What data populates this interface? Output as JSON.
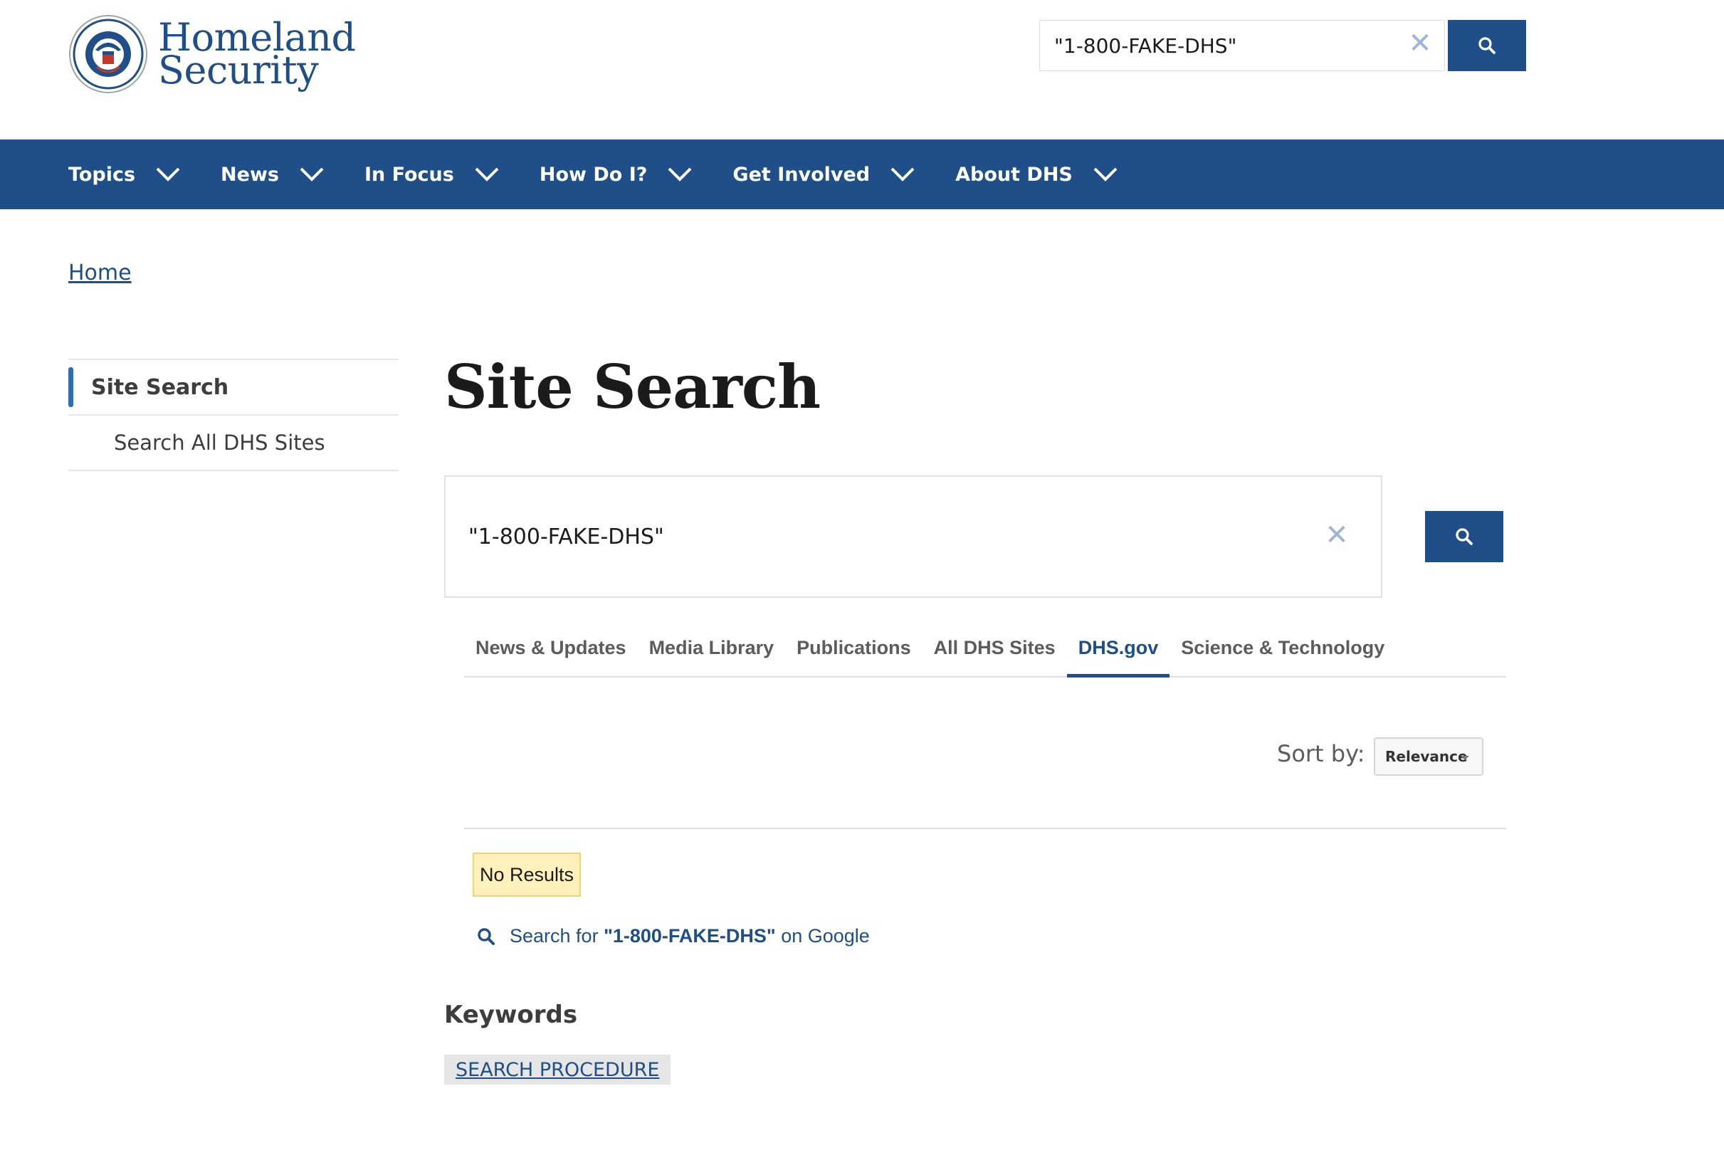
{
  "header": {
    "logo_line1": "Homeland",
    "logo_line2": "Security",
    "search_value": "\"1-800-FAKE-DHS\"",
    "clear_symbol": "✕"
  },
  "nav": {
    "items": [
      {
        "label": "Topics"
      },
      {
        "label": "News"
      },
      {
        "label": "In Focus"
      },
      {
        "label": "How Do I?"
      },
      {
        "label": "Get Involved"
      },
      {
        "label": "About DHS"
      }
    ]
  },
  "breadcrumb": {
    "home": "Home"
  },
  "sidenav": {
    "active": "Site Search",
    "sub": "Search All DHS Sites"
  },
  "main": {
    "title": "Site Search",
    "search_value": "\"1-800-FAKE-DHS\"",
    "clear_symbol": "✕",
    "tabs": [
      {
        "label": "News & Updates"
      },
      {
        "label": "Media Library"
      },
      {
        "label": "Publications"
      },
      {
        "label": "All DHS Sites"
      },
      {
        "label": "DHS.gov"
      },
      {
        "label": "Science & Technology"
      }
    ],
    "active_tab": "DHS.gov",
    "sort_label": "Sort by:",
    "sort_value": "Relevance",
    "no_results": "No Results",
    "google_prefix": "Search for ",
    "google_query": "\"1-800-FAKE-DHS\"",
    "google_suffix": " on Google",
    "keywords_title": "Keywords",
    "keyword_tag": "SEARCH PROCEDURE"
  },
  "colors": {
    "brand_blue": "#1f4e88",
    "highlight_yellow": "#fff1bc",
    "accent_bar": "#2e6eb5"
  },
  "icons": [
    "dhs-seal-icon",
    "search-icon",
    "close-icon",
    "chevron-down-icon"
  ]
}
